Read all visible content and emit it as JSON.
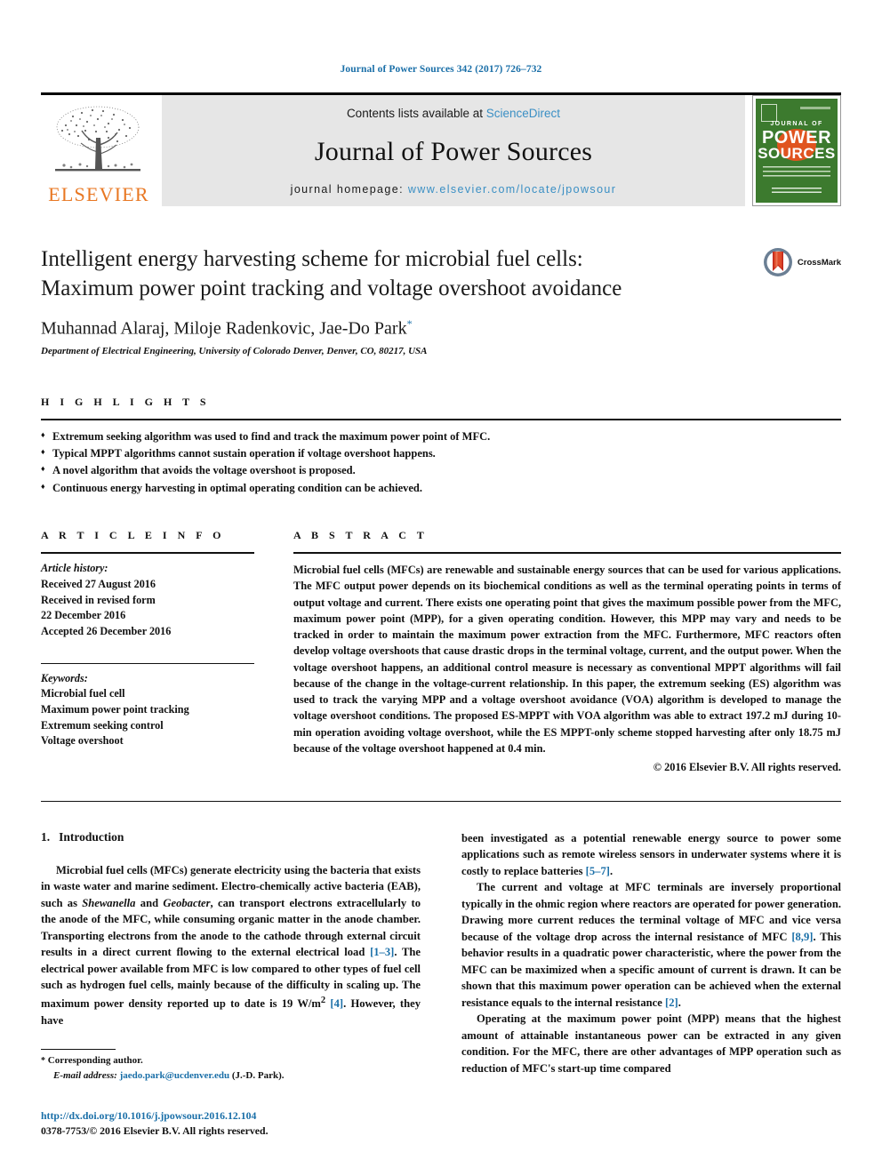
{
  "running_head": "Journal of Power Sources 342 (2017) 726–732",
  "masthead": {
    "contents_prefix": "Contents lists available at ",
    "sciencedirect": "ScienceDirect",
    "journal_title": "Journal of Power Sources",
    "homepage_prefix": "journal homepage: ",
    "homepage_url": "www.elsevier.com/locate/jpowsour",
    "publisher_logo_text": "ELSEVIER",
    "cover": {
      "journal_of": "JOURNAL OF",
      "power": "POWER",
      "sources": "SOURCES"
    }
  },
  "article": {
    "title_line1": "Intelligent energy harvesting scheme for microbial fuel cells:",
    "title_line2": "Maximum power point tracking and voltage overshoot avoidance",
    "authors": "Muhannad Alaraj, Miloje Radenkovic, Jae-Do Park",
    "corresponding_marker": "*",
    "affiliation": "Department of Electrical Engineering, University of Colorado Denver, Denver, CO, 80217, USA",
    "crossmark_label": "CrossMark"
  },
  "highlights": {
    "heading": "H I G H L I G H T S",
    "items": [
      "Extremum seeking algorithm was used to find and track the maximum power point of MFC.",
      "Typical MPPT algorithms cannot sustain operation if voltage overshoot happens.",
      "A novel algorithm that avoids the voltage overshoot is proposed.",
      "Continuous energy harvesting in optimal operating condition can be achieved."
    ]
  },
  "article_info": {
    "heading": "A R T I C L E   I N F O",
    "history_caption": "Article history:",
    "history": [
      "Received 27 August 2016",
      "Received in revised form",
      "22 December 2016",
      "Accepted 26 December 2016"
    ],
    "keywords_caption": "Keywords:",
    "keywords": [
      "Microbial fuel cell",
      "Maximum power point tracking",
      "Extremum seeking control",
      "Voltage overshoot"
    ]
  },
  "abstract": {
    "heading": "A B S T R A C T",
    "text": "Microbial fuel cells (MFCs) are renewable and sustainable energy sources that can be used for various applications. The MFC output power depends on its biochemical conditions as well as the terminal operating points in terms of output voltage and current. There exists one operating point that gives the maximum possible power from the MFC, maximum power point (MPP), for a given operating condition. However, this MPP may vary and needs to be tracked in order to maintain the maximum power extraction from the MFC. Furthermore, MFC reactors often develop voltage overshoots that cause drastic drops in the terminal voltage, current, and the output power. When the voltage overshoot happens, an additional control measure is necessary as conventional MPPT algorithms will fail because of the change in the voltage-current relationship. In this paper, the extremum seeking (ES) algorithm was used to track the varying MPP and a voltage overshoot avoidance (VOA) algorithm is developed to manage the voltage overshoot conditions. The proposed ES-MPPT with VOA algorithm was able to extract 197.2 mJ during 10-min operation avoiding voltage overshoot, while the ES MPPT-only scheme stopped harvesting after only 18.75 mJ because of the voltage overshoot happened at 0.4 min.",
    "copyright": "© 2016 Elsevier B.V. All rights reserved."
  },
  "body": {
    "section_number": "1.",
    "section_title": "Introduction",
    "left_paragraph_parts": {
      "p1_a": "Microbial fuel cells (MFCs) generate electricity using the bacteria that exists in waste water and marine sediment. Electro-chemically active bacteria (EAB), such as ",
      "p1_italic1": "Shewanella",
      "p1_b": " and ",
      "p1_italic2": "Geobacter",
      "p1_c": ", can transport electrons extracellularly to the anode of the MFC, while consuming organic matter in the anode chamber. Transporting electrons from the anode to the cathode through external circuit results in a direct current flowing to the external electrical load ",
      "p1_ref1": "[1–3]",
      "p1_d": ". The electrical power available from MFC is low compared to other types of fuel cell such as hydrogen fuel cells, mainly because of the difficulty in scaling up. The maximum power density reported up to date is 19 W/m",
      "p1_sup": "2",
      "p1_e": " ",
      "p1_ref2": "[4]",
      "p1_f": ". However, they have"
    },
    "right_paragraph_parts": {
      "p1_a": "been investigated as a potential renewable energy source to power some applications such as remote wireless sensors in underwater systems where it is costly to replace batteries ",
      "p1_ref": "[5–7]",
      "p1_b": ".",
      "p2_a": "The current and voltage at MFC terminals are inversely proportional typically in the ohmic region where reactors are operated for power generation. Drawing more current reduces the terminal voltage of MFC and vice versa because of the voltage drop across the internal resistance of MFC ",
      "p2_ref1": "[8,9]",
      "p2_b": ". This behavior results in a quadratic power characteristic, where the power from the MFC can be maximized when a specific amount of current is drawn. It can be shown that this maximum power operation can be achieved when the external resistance equals to the internal resistance ",
      "p2_ref2": "[2]",
      "p2_c": ".",
      "p3": "Operating at the maximum power point (MPP) means that the highest amount of attainable instantaneous power can be extracted in any given condition. For the MFC, there are other advantages of MPP operation such as reduction of MFC's start-up time compared"
    }
  },
  "footnote": {
    "star": "*",
    "corresponding": "Corresponding author.",
    "email_label": "E-mail address:",
    "email": "jaedo.park@ucdenver.edu",
    "email_suffix": "(J.-D. Park)."
  },
  "doi": {
    "url": "http://dx.doi.org/10.1016/j.jpowsour.2016.12.104",
    "issn_line": "0378-7753/© 2016 Elsevier B.V. All rights reserved."
  },
  "colors": {
    "link_blue": "#1a6fa8",
    "sciencedirect_blue": "#3a8fc4",
    "elsevier_orange": "#e87722",
    "cover_green": "#3c7a2e"
  }
}
